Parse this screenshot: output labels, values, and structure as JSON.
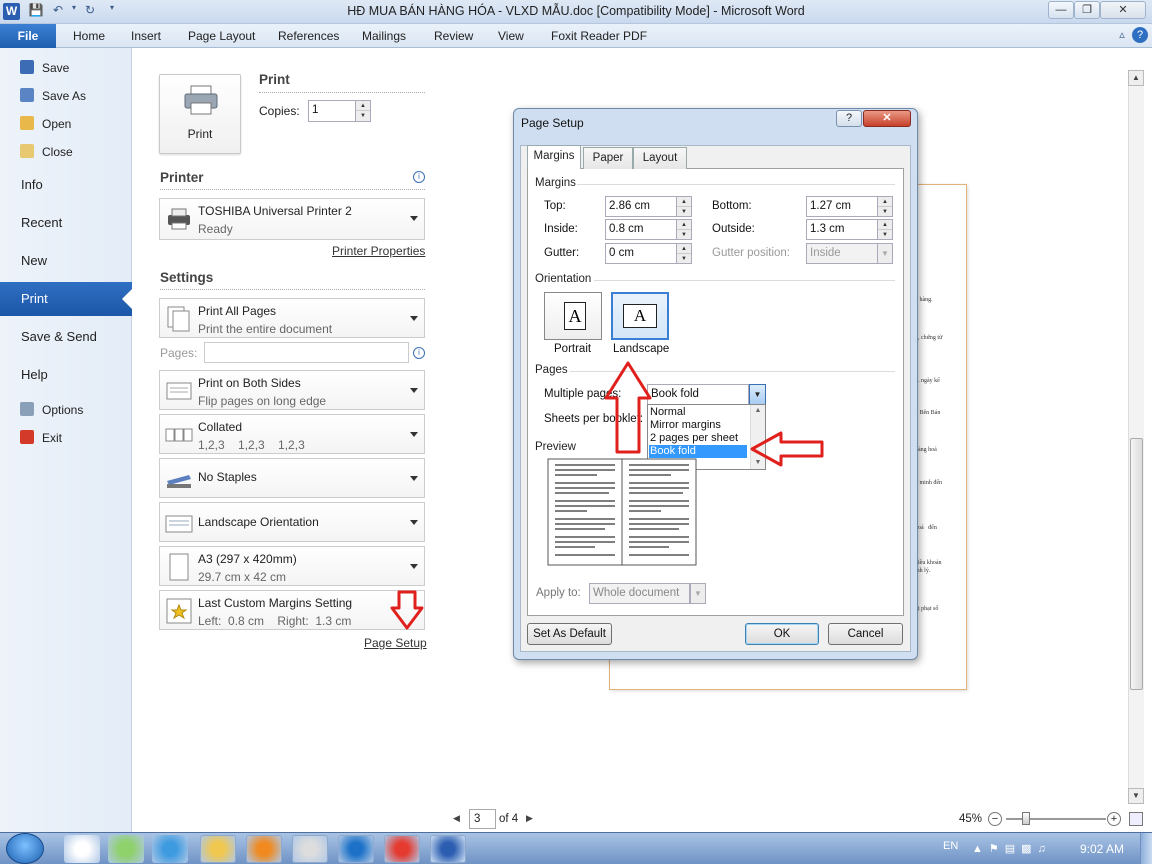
{
  "window": {
    "title": "HĐ MUA BÁN HÀNG HÓA - VLXD MẪU.doc [Compatibility Mode]  -  Microsoft Word",
    "app_icon": "W"
  },
  "ribbon": {
    "tabs": [
      "File",
      "Home",
      "Insert",
      "Page Layout",
      "References",
      "Mailings",
      "Review",
      "View",
      "Foxit Reader PDF"
    ]
  },
  "nav": {
    "small": [
      "Save",
      "Save As",
      "Open",
      "Close"
    ],
    "big": [
      "Info",
      "Recent",
      "New",
      "Print",
      "Save & Send",
      "Help"
    ],
    "bottom": [
      "Options",
      "Exit"
    ]
  },
  "print": {
    "heading": "Print",
    "button_label": "Print",
    "copies_label": "Copies:",
    "copies_value": "1",
    "printer_heading": "Printer",
    "printer_name": "TOSHIBA Universal Printer 2",
    "printer_status": "Ready",
    "printer_properties": "Printer Properties",
    "settings_heading": "Settings",
    "pages_label": "Pages:",
    "settings": [
      {
        "l1": "Print All Pages",
        "l2": "Print the entire document"
      },
      {
        "l1": "Print on Both Sides",
        "l2": "Flip pages on long edge"
      },
      {
        "l1": "Collated",
        "l2": "1,2,3    1,2,3    1,2,3"
      },
      {
        "l1": "No Staples",
        "l2": ""
      },
      {
        "l1": "Landscape Orientation",
        "l2": ""
      },
      {
        "l1": "A3 (297 x 420mm)",
        "l2": "29.7 cm x 42 cm"
      },
      {
        "l1": "Last Custom Margins Setting",
        "l2": "Left:  0.8 cm    Right:  1.3 cm"
      }
    ],
    "page_setup_link": "Page Setup"
  },
  "preview": {
    "snippets": [
      "o hàng.",
      "n, chứng từ",
      "... ngày kể",
      "o Bên Bán",
      "hàng hoá",
      "n minh đến",
      "hoá   đến",
      "hiều khoản",
      "inh lý.",
      "bị phạt số"
    ],
    "current_page": "3",
    "of_pages": "of 4",
    "zoom": "45%"
  },
  "dialog": {
    "title": "Page Setup",
    "help": "?",
    "tabs": [
      "Margins",
      "Paper",
      "Layout"
    ],
    "margins_heading": "Margins",
    "top_label": "Top:",
    "top": "2.86 cm",
    "bottom_label": "Bottom:",
    "bottom": "1.27 cm",
    "inside_label": "Inside:",
    "inside": "0.8 cm",
    "outside_label": "Outside:",
    "outside": "1.3 cm",
    "gutter_label": "Gutter:",
    "gutter": "0 cm",
    "gutter_pos_label": "Gutter position:",
    "gutter_pos": "Inside",
    "orientation_heading": "Orientation",
    "portrait": "Portrait",
    "landscape": "Landscape",
    "pages_heading": "Pages",
    "multiple_pages_label": "Multiple pages:",
    "multiple_pages_value": "Book fold",
    "sheets_label": "Sheets per booklet:",
    "list_options": [
      "Normal",
      "Mirror margins",
      "2 pages per sheet",
      "Book fold"
    ],
    "preview_heading": "Preview",
    "apply_label": "Apply to:",
    "apply_value": "Whole document",
    "set_default": "Set As Default",
    "ok": "OK",
    "cancel": "Cancel"
  },
  "taskbar": {
    "lang": "EN",
    "time": "9:02 AM"
  },
  "colors": {
    "accent": "#1f5fae",
    "highlight": "#3399ff",
    "annotation": "#e0201c"
  }
}
